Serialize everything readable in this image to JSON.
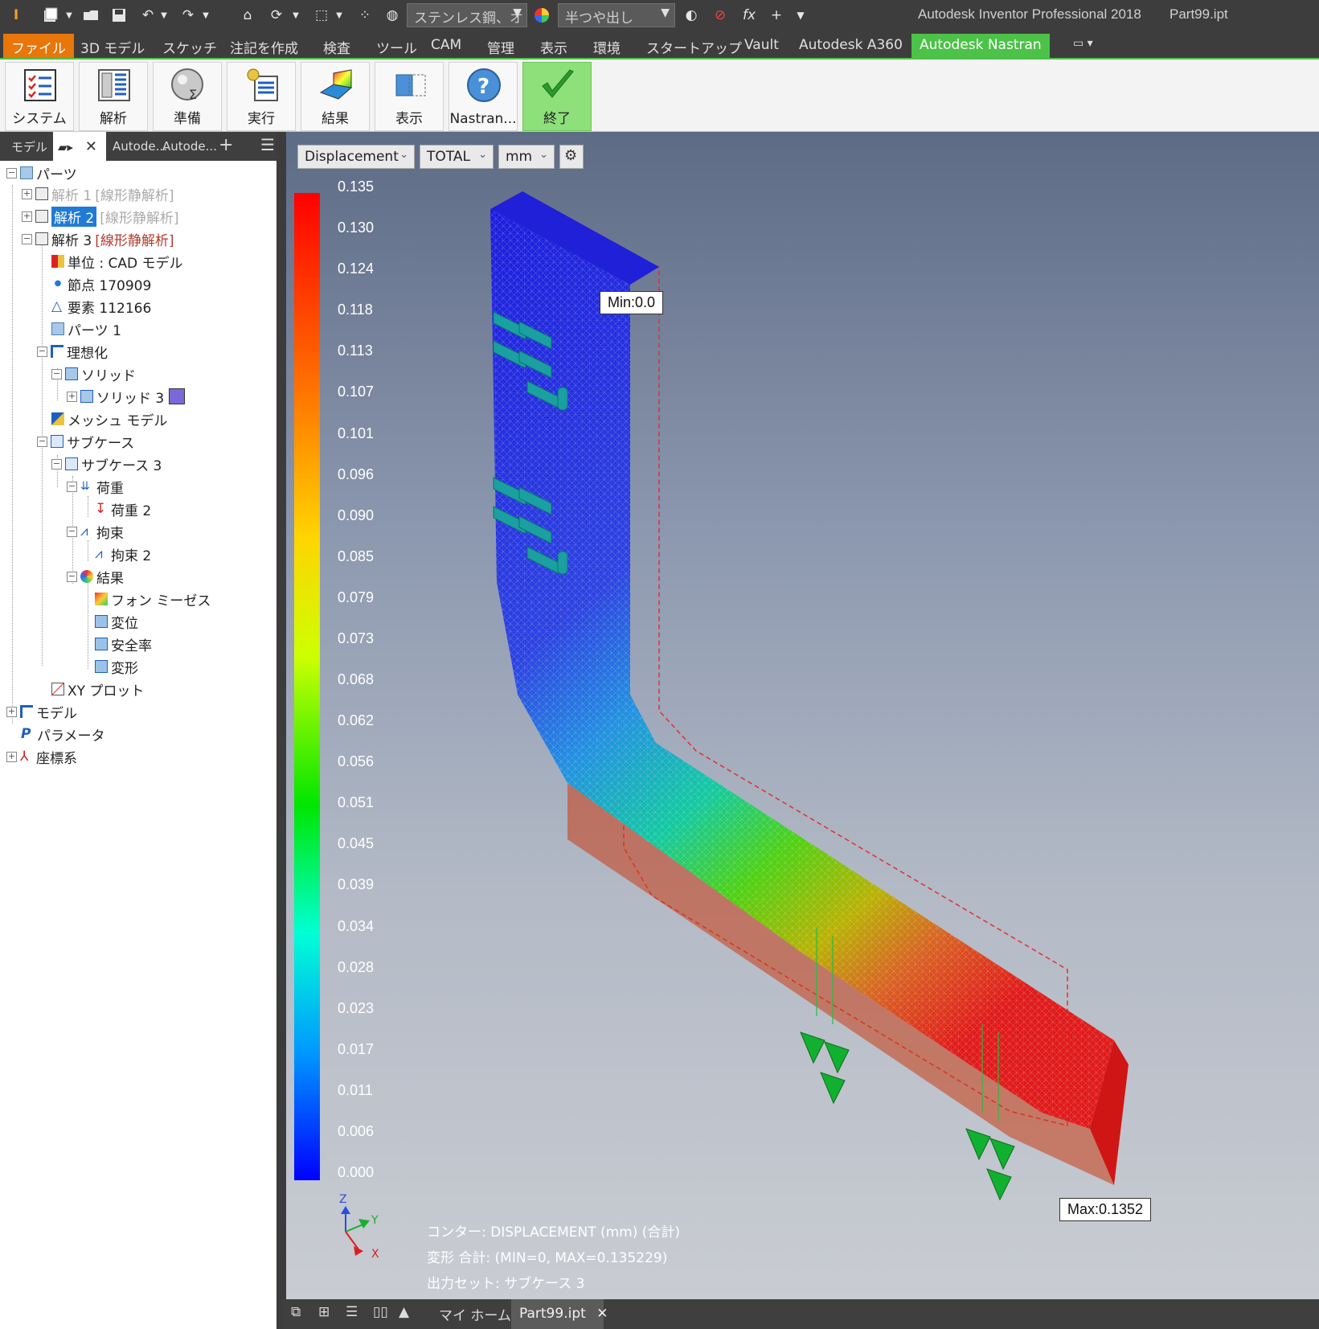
{
  "titlebar": {
    "material": "ステンレス鋼、オ",
    "appearance": "半つや出し",
    "app_title": "Autodesk Inventor Professional 2018",
    "file_title": "Part99.ipt",
    "fx": "fx"
  },
  "tabs": [
    {
      "label": "ファイル"
    },
    {
      "label": "3D モデル"
    },
    {
      "label": "スケッチ"
    },
    {
      "label": "注記を作成"
    },
    {
      "label": "検査"
    },
    {
      "label": "ツール"
    },
    {
      "label": "CAM"
    },
    {
      "label": "管理"
    },
    {
      "label": "表示"
    },
    {
      "label": "環境"
    },
    {
      "label": "スタートアップ"
    },
    {
      "label": "Vault"
    },
    {
      "label": "Autodesk A360"
    },
    {
      "label": "Autodesk Nastran"
    }
  ],
  "ribbon": [
    {
      "label": "システム"
    },
    {
      "label": "解析"
    },
    {
      "label": "準備"
    },
    {
      "label": "実行"
    },
    {
      "label": "結果"
    },
    {
      "label": "表示"
    },
    {
      "label": "Nastran..."
    },
    {
      "label": "終了"
    }
  ],
  "browser": {
    "tab_model": "モデル",
    "tab_a": "Autode...",
    "tab_b": "Autode...",
    "add": "+",
    "menu": "☰",
    "close": "✕",
    "tree": {
      "parts": "パーツ",
      "analysis1": "解析 1",
      "analysis1_tag": "[線形静解析]",
      "analysis2": "解析 2",
      "analysis2_tag": "[線形静解析]",
      "analysis3": "解析 3",
      "analysis3_tag": "[線形静解析]",
      "units": "単位 : CAD モデル",
      "nodes": "節点 170909",
      "elements": "要素 112166",
      "parts1": "パーツ 1",
      "idealization": "理想化",
      "solid": "ソリッド",
      "solid3": "ソリッド 3",
      "mesh": "メッシュ モデル",
      "subcase": "サブケース",
      "subcase3": "サブケース 3",
      "loads": "荷重",
      "load2": "荷重 2",
      "constraints": "拘束",
      "constraint2": "拘束 2",
      "results": "結果",
      "vonmises": "フォン ミーゼス",
      "displacement": "変位",
      "safety": "安全率",
      "deformation": "変形",
      "xyplot": "XY プロット",
      "model": "モデル",
      "params": "パラメータ",
      "coords": "座標系",
      "solid3_color": "#7b68d8"
    }
  },
  "viewport": {
    "result_type": "Displacement",
    "component": "TOTAL",
    "unit": "mm",
    "legend_ticks": [
      "0.135",
      "0.130",
      "0.124",
      "0.118",
      "0.113",
      "0.107",
      "0.101",
      "0.096",
      "0.090",
      "0.085",
      "0.079",
      "0.073",
      "0.068",
      "0.062",
      "0.056",
      "0.051",
      "0.045",
      "0.039",
      "0.034",
      "0.028",
      "0.023",
      "0.017",
      "0.011",
      "0.006",
      "0.000"
    ],
    "min_label": "Min:0.0",
    "max_label": "Max:0.1352",
    "info_contour": "コンター: DISPLACEMENT (mm) (合計)",
    "info_deform": "変形 合計: (MIN=0, MAX=0.135229)",
    "info_output": "出力セット: サブケース 3",
    "axis_z": "Z",
    "axis_y": "Y",
    "axis_x": "X"
  },
  "bottombar": {
    "home": "マイ ホーム",
    "doc": "Part99.ipt",
    "close": "✕"
  },
  "colors": {
    "accent_green": "#4cc248",
    "file_orange": "#e8760a",
    "selection_blue": "#1f7bd6"
  }
}
